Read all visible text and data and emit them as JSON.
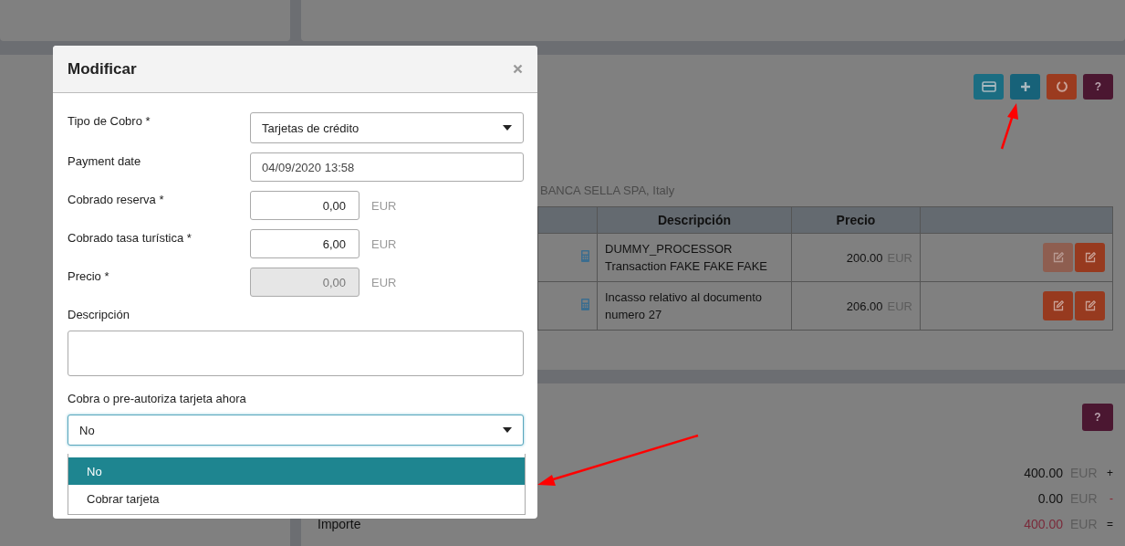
{
  "background": {
    "toolbar_buttons": [
      {
        "kind": "card",
        "color": "#1b6d82"
      },
      {
        "kind": "add",
        "color": "#176279"
      },
      {
        "kind": "refresh",
        "color": "#9b3b1f"
      },
      {
        "kind": "help",
        "label": "?",
        "color": "#4b1731"
      }
    ],
    "bank_text": "BANCA SELLA SPA, Italy",
    "table": {
      "columns": [
        "Descripción",
        "Precio"
      ],
      "rows": [
        {
          "description": "DUMMY_PROCESSOR Transaction FAKE FAKE FAKE",
          "price": "200.00",
          "currency": "EUR",
          "edit_buttons": [
            {
              "disabled": true
            },
            {
              "disabled": false
            }
          ]
        },
        {
          "description": "Incasso relativo al documento numero 27",
          "price": "206.00",
          "currency": "EUR",
          "edit_buttons": [
            {
              "disabled": false
            },
            {
              "disabled": false
            }
          ]
        }
      ]
    },
    "summary": {
      "help": "?",
      "lines": [
        {
          "value": "400.00",
          "currency": "EUR",
          "sign": "+",
          "kind": "add"
        },
        {
          "value": "0.00",
          "currency": "EUR",
          "sign": "-",
          "kind": "subtract"
        },
        {
          "label": "Importe",
          "value": "400.00",
          "currency": "EUR",
          "sign": "=",
          "kind": "total"
        }
      ]
    }
  },
  "modal": {
    "title": "Modificar",
    "fields": [
      {
        "kind": "select",
        "label": "Tipo de Cobro  *",
        "value": "Tarjetas de crédito"
      },
      {
        "kind": "text",
        "label": "Payment date",
        "value": "04/09/2020 13:58"
      },
      {
        "kind": "number",
        "label": "Cobrado reserva  *",
        "value": "0,00",
        "unit": "EUR",
        "disabled": false
      },
      {
        "kind": "number",
        "label": "Cobrado tasa turística  *",
        "value": "6,00",
        "unit": "EUR",
        "disabled": false
      },
      {
        "kind": "number",
        "label": "Precio  *",
        "value": "0,00",
        "unit": "EUR",
        "disabled": true
      }
    ],
    "description": {
      "label": "Descripción"
    },
    "charge": {
      "label": "Cobra o pre-autoriza tarjeta ahora",
      "value": "No",
      "expanded": true,
      "options": [
        {
          "label": "No",
          "selected": true
        },
        {
          "label": "Cobrar tarjeta",
          "selected": false
        }
      ]
    }
  }
}
